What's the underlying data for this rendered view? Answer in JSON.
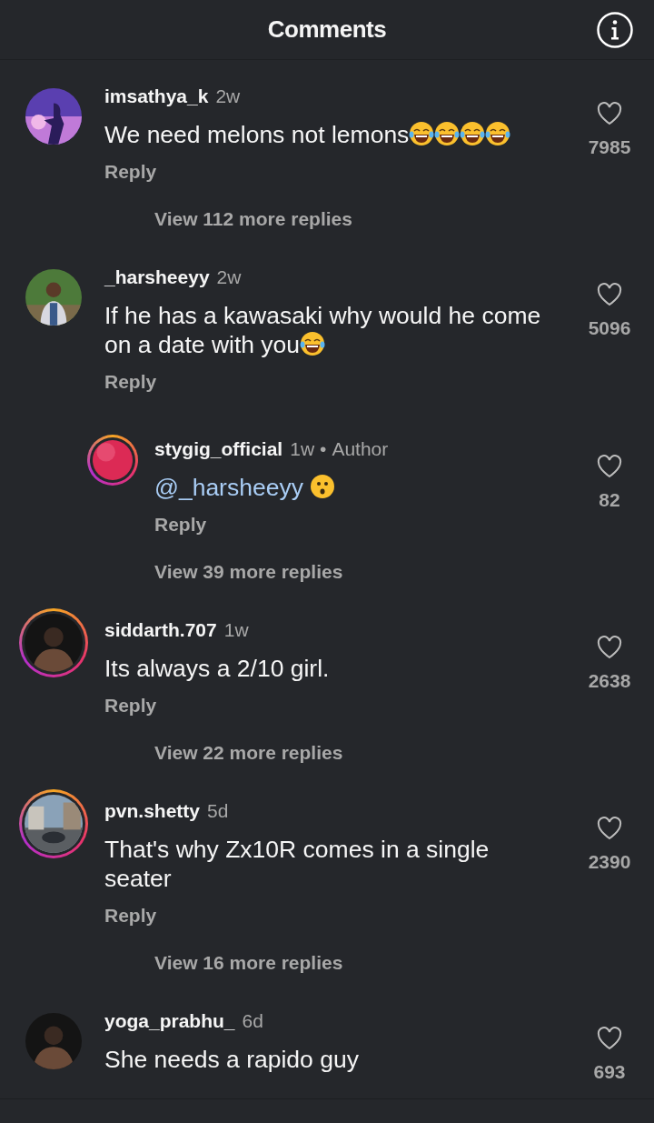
{
  "header": {
    "title": "Comments"
  },
  "comments": [
    {
      "user": "imsathya_k",
      "time": "2w",
      "text": "We need melons not lemons",
      "emojis": [
        {
          "kind": "laughing"
        },
        {
          "kind": "laughing"
        },
        {
          "kind": "laughing"
        },
        {
          "kind": "laughing"
        }
      ],
      "reply": "Reply",
      "likes": "7985",
      "story_ring": false,
      "view_more": "View 112 more replies"
    },
    {
      "user": "_harsheeyy",
      "time": "2w",
      "text": "If he has a kawasaki why would he come on a date with you",
      "emojis": [
        {
          "kind": "laughing"
        }
      ],
      "reply": "Reply",
      "likes": "5096",
      "story_ring": false,
      "children": [
        {
          "user": "stygig_official",
          "time": "1w",
          "separator": "•",
          "badge": "Author",
          "mention": "@_harsheeyy",
          "emojis": [
            {
              "kind": "surprised"
            }
          ],
          "reply": "Reply",
          "likes": "82",
          "story_ring": true
        }
      ],
      "view_more": "View 39 more replies"
    },
    {
      "user": "siddarth.707",
      "time": "1w",
      "text": "Its always a 2/10 girl.",
      "reply": "Reply",
      "likes": "2638",
      "story_ring": true,
      "view_more": "View 22 more replies"
    },
    {
      "user": "pvn.shetty",
      "time": "5d",
      "text": "That's why Zx10R comes in a single seater",
      "reply": "Reply",
      "likes": "2390",
      "story_ring": true,
      "view_more": "View 16 more replies"
    },
    {
      "user": "yoga_prabhu_",
      "time": "6d",
      "text": "She needs a rapido guy",
      "likes": "693",
      "story_ring": false
    }
  ]
}
